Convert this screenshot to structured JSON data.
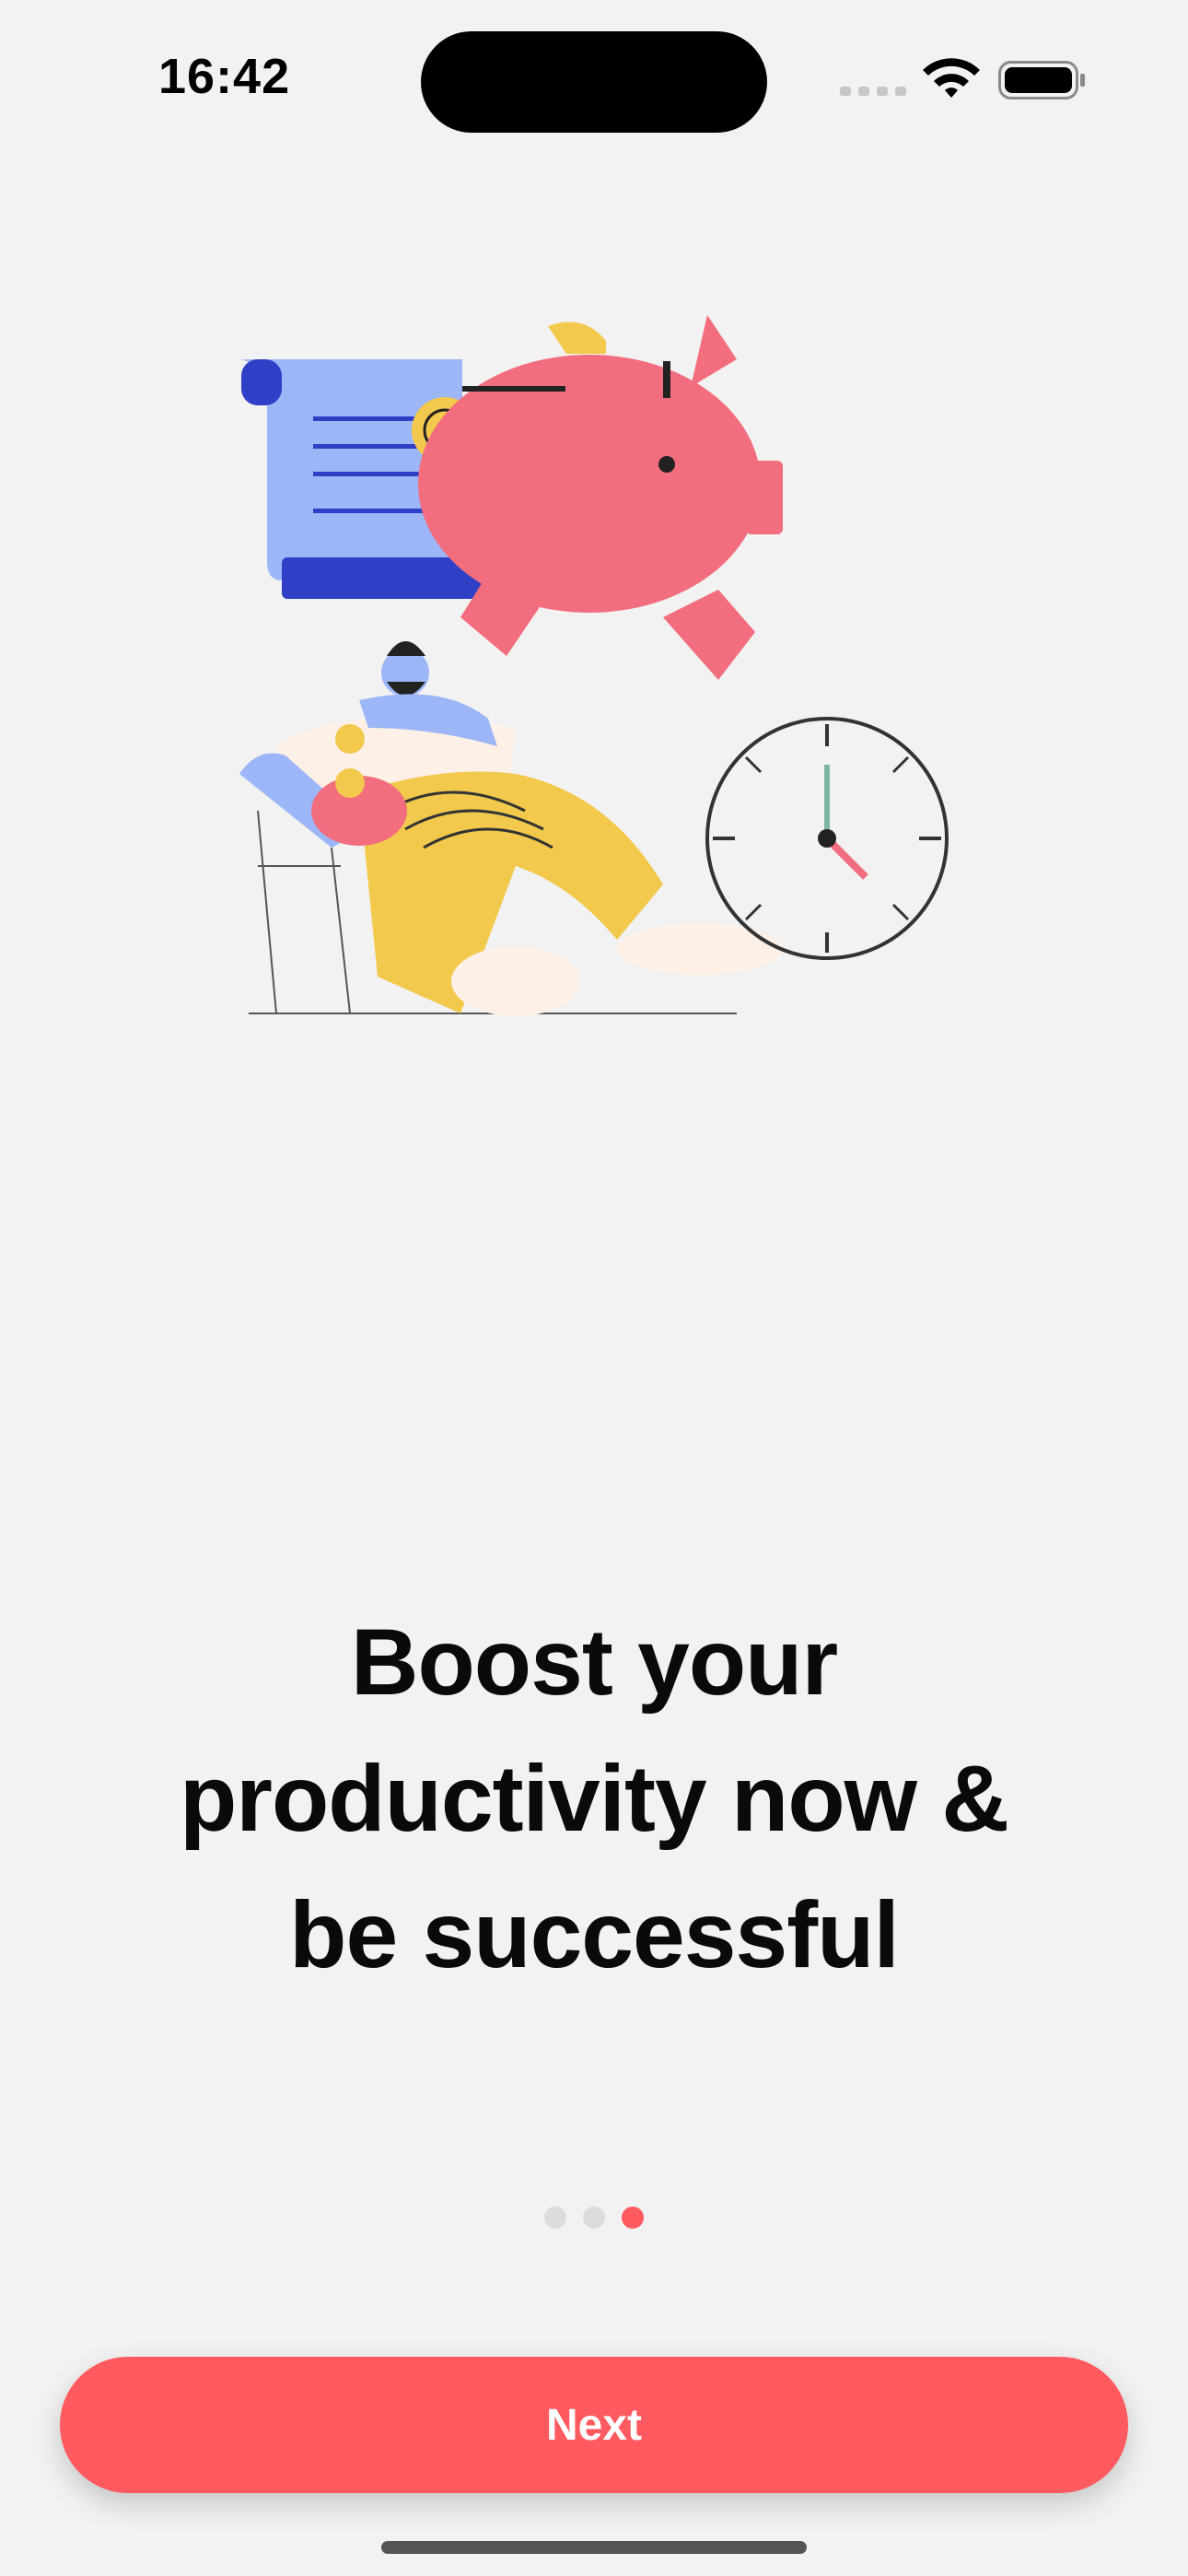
{
  "status_bar": {
    "time": "16:42",
    "icons": [
      "signal-icon",
      "wifi-icon",
      "battery-icon"
    ]
  },
  "illustration": {
    "elements": [
      "certificate",
      "piggy-bank",
      "man-relaxing-in-chair",
      "clock"
    ]
  },
  "headline": {
    "line1": "Boost your",
    "line2": "productivity now &",
    "line3": "be successful"
  },
  "pagination": {
    "total": 3,
    "current": 3
  },
  "next_button": {
    "label": "Next"
  },
  "colors": {
    "accent": "#ff5a5f",
    "background": "#f2f2f2",
    "piggy": "#f26d7d",
    "certificate": "#9cb6f7",
    "certificate_dark": "#2f3fc6",
    "seal": "#f2c94c",
    "pants": "#f2c94c"
  }
}
